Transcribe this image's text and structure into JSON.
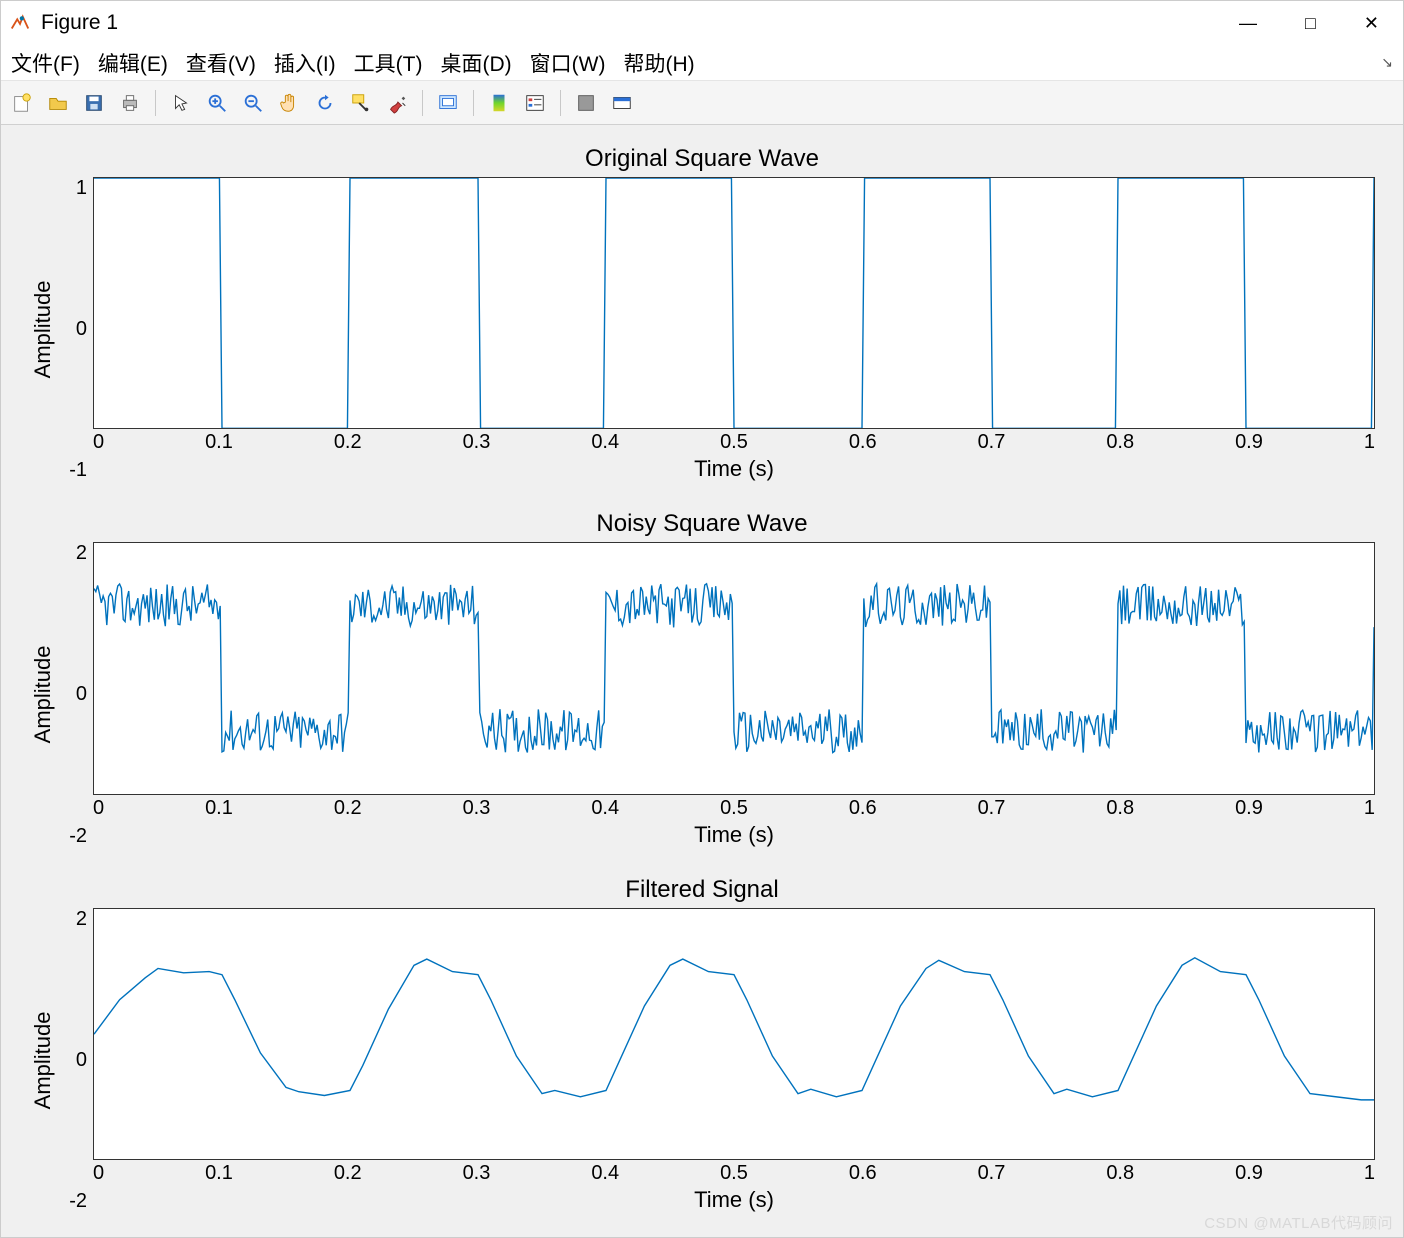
{
  "window": {
    "title": "Figure 1",
    "buttons": {
      "min": "—",
      "max": "□",
      "close": "✕"
    }
  },
  "menubar": {
    "items": [
      "文件(F)",
      "编辑(E)",
      "查看(V)",
      "插入(I)",
      "工具(T)",
      "桌面(D)",
      "窗口(W)",
      "帮助(H)"
    ],
    "dock": "↘"
  },
  "toolbar": {
    "icons": [
      "new-figure",
      "open",
      "save",
      "print",
      "SEP",
      "pointer",
      "zoom-in",
      "zoom-out",
      "pan",
      "rotate",
      "data-cursor",
      "brush",
      "SEP",
      "link",
      "SEP",
      "colorbar",
      "legend",
      "SEP",
      "hide-tools",
      "show-tools"
    ]
  },
  "watermark": "CSDN @MATLAB代码顾问",
  "chart_data": [
    {
      "type": "line",
      "title": "Original Square Wave",
      "xlabel": "Time (s)",
      "ylabel": "Amplitude",
      "xlim": [
        0,
        1
      ],
      "ylim": [
        -1,
        1
      ],
      "xticks": [
        0,
        0.1,
        0.2,
        0.3,
        0.4,
        0.5,
        0.6,
        0.7,
        0.8,
        0.9,
        1
      ],
      "yticks": [
        -1,
        0,
        1
      ],
      "kind": "square",
      "period": 0.2,
      "high": 1,
      "low": -1
    },
    {
      "type": "line",
      "title": "Noisy Square Wave",
      "xlabel": "Time (s)",
      "ylabel": "Amplitude",
      "xlim": [
        0,
        1
      ],
      "ylim": [
        -2,
        2
      ],
      "xticks": [
        0,
        0.1,
        0.2,
        0.3,
        0.4,
        0.5,
        0.6,
        0.7,
        0.8,
        0.9,
        1
      ],
      "yticks": [
        -2,
        0,
        2
      ],
      "kind": "noisy-square",
      "period": 0.2,
      "high": 1,
      "low": -1,
      "noise_amp": 0.35
    },
    {
      "type": "line",
      "title": "Filtered Signal",
      "xlabel": "Time (s)",
      "ylabel": "Amplitude",
      "xlim": [
        0,
        1
      ],
      "ylim": [
        -2,
        2
      ],
      "xticks": [
        0,
        0.1,
        0.2,
        0.3,
        0.4,
        0.5,
        0.6,
        0.7,
        0.8,
        0.9,
        1
      ],
      "yticks": [
        -2,
        0,
        2
      ],
      "kind": "filtered",
      "series": [
        {
          "x": 0.0,
          "y": 0.0
        },
        {
          "x": 0.02,
          "y": 0.55
        },
        {
          "x": 0.04,
          "y": 0.9
        },
        {
          "x": 0.05,
          "y": 1.05
        },
        {
          "x": 0.07,
          "y": 0.98
        },
        {
          "x": 0.09,
          "y": 1.0
        },
        {
          "x": 0.1,
          "y": 0.95
        },
        {
          "x": 0.11,
          "y": 0.55
        },
        {
          "x": 0.13,
          "y": -0.3
        },
        {
          "x": 0.15,
          "y": -0.85
        },
        {
          "x": 0.16,
          "y": -0.92
        },
        {
          "x": 0.18,
          "y": -0.98
        },
        {
          "x": 0.2,
          "y": -0.9
        },
        {
          "x": 0.21,
          "y": -0.5
        },
        {
          "x": 0.23,
          "y": 0.4
        },
        {
          "x": 0.25,
          "y": 1.1
        },
        {
          "x": 0.26,
          "y": 1.2
        },
        {
          "x": 0.28,
          "y": 1.0
        },
        {
          "x": 0.3,
          "y": 0.95
        },
        {
          "x": 0.31,
          "y": 0.55
        },
        {
          "x": 0.33,
          "y": -0.35
        },
        {
          "x": 0.35,
          "y": -0.95
        },
        {
          "x": 0.36,
          "y": -0.9
        },
        {
          "x": 0.38,
          "y": -1.0
        },
        {
          "x": 0.4,
          "y": -0.9
        },
        {
          "x": 0.41,
          "y": -0.45
        },
        {
          "x": 0.43,
          "y": 0.45
        },
        {
          "x": 0.45,
          "y": 1.1
        },
        {
          "x": 0.46,
          "y": 1.2
        },
        {
          "x": 0.48,
          "y": 1.0
        },
        {
          "x": 0.5,
          "y": 0.95
        },
        {
          "x": 0.51,
          "y": 0.55
        },
        {
          "x": 0.53,
          "y": -0.35
        },
        {
          "x": 0.55,
          "y": -0.95
        },
        {
          "x": 0.56,
          "y": -0.88
        },
        {
          "x": 0.58,
          "y": -1.0
        },
        {
          "x": 0.6,
          "y": -0.9
        },
        {
          "x": 0.61,
          "y": -0.45
        },
        {
          "x": 0.63,
          "y": 0.45
        },
        {
          "x": 0.65,
          "y": 1.05
        },
        {
          "x": 0.66,
          "y": 1.18
        },
        {
          "x": 0.68,
          "y": 1.0
        },
        {
          "x": 0.7,
          "y": 0.95
        },
        {
          "x": 0.71,
          "y": 0.55
        },
        {
          "x": 0.73,
          "y": -0.35
        },
        {
          "x": 0.75,
          "y": -0.95
        },
        {
          "x": 0.76,
          "y": -0.88
        },
        {
          "x": 0.78,
          "y": -1.0
        },
        {
          "x": 0.8,
          "y": -0.9
        },
        {
          "x": 0.81,
          "y": -0.45
        },
        {
          "x": 0.83,
          "y": 0.45
        },
        {
          "x": 0.85,
          "y": 1.1
        },
        {
          "x": 0.86,
          "y": 1.22
        },
        {
          "x": 0.88,
          "y": 1.0
        },
        {
          "x": 0.9,
          "y": 0.95
        },
        {
          "x": 0.91,
          "y": 0.55
        },
        {
          "x": 0.93,
          "y": -0.35
        },
        {
          "x": 0.95,
          "y": -0.95
        },
        {
          "x": 0.97,
          "y": -1.0
        },
        {
          "x": 0.99,
          "y": -1.05
        },
        {
          "x": 1.0,
          "y": -1.05
        }
      ]
    }
  ]
}
